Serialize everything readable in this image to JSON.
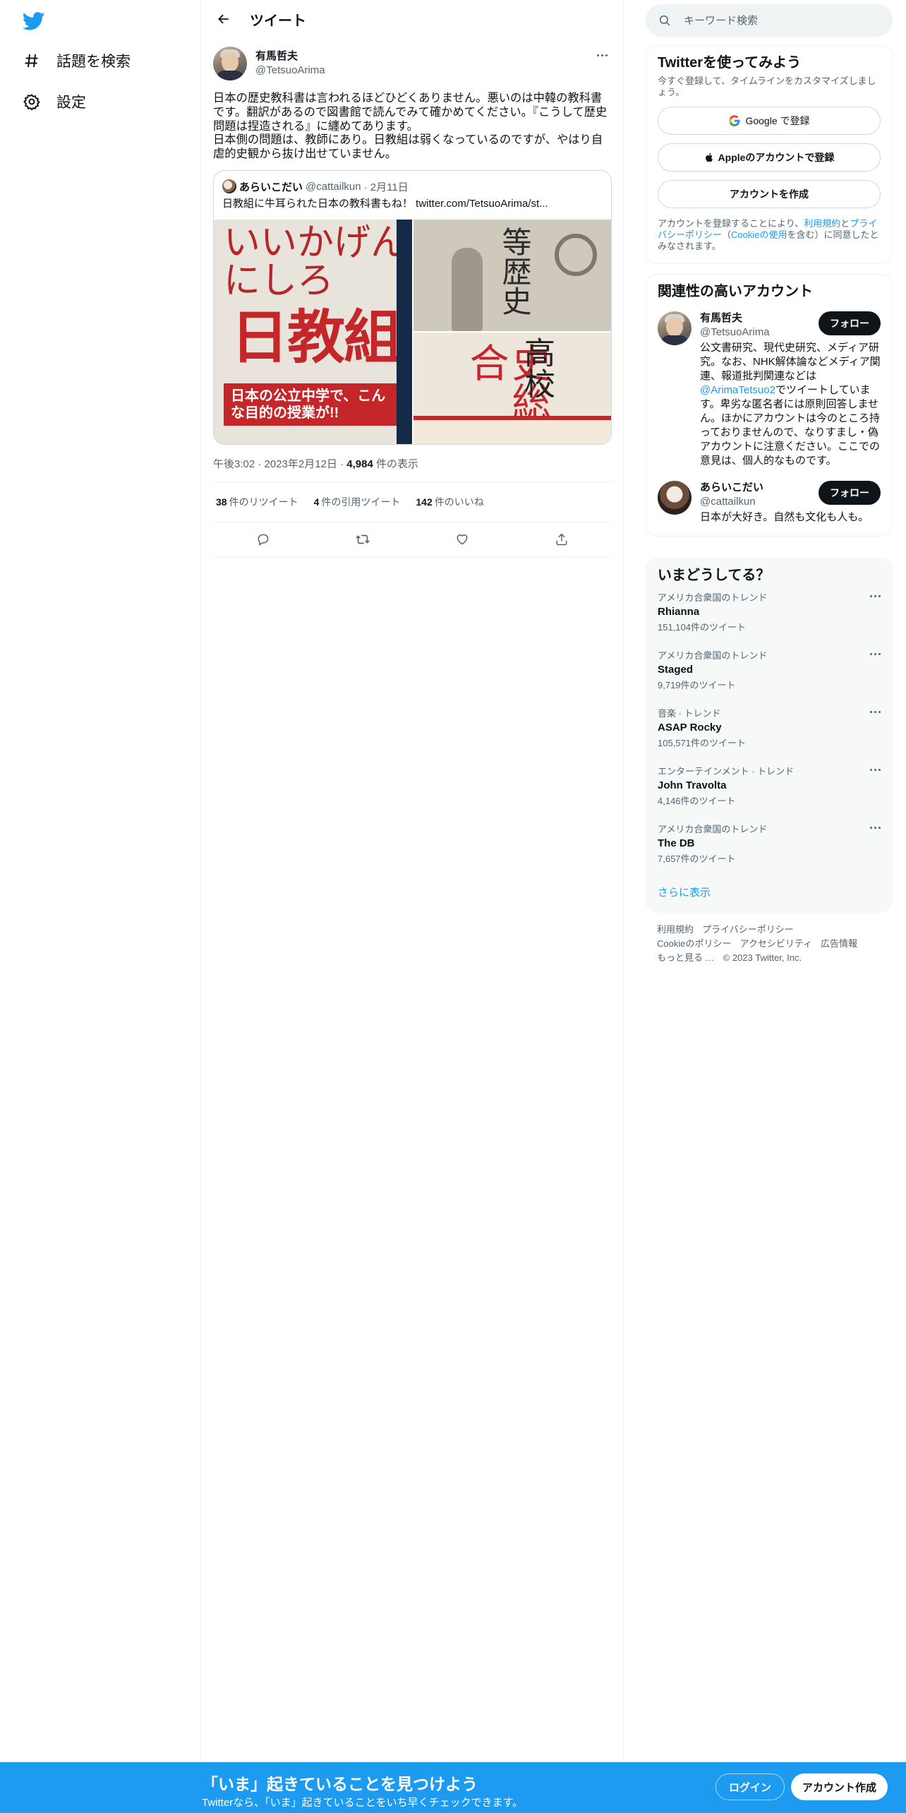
{
  "leftnav": {
    "logo_icon": "twitter-bird-icon",
    "items": [
      {
        "icon": "hashtag-icon",
        "label": "話題を検索"
      },
      {
        "icon": "gear-icon",
        "label": "設定"
      }
    ]
  },
  "header": {
    "back_icon": "arrow-left-icon",
    "title": "ツイート"
  },
  "tweet": {
    "author_name": "有馬哲夫",
    "author_handle": "@TetsuoArima",
    "text": "日本の歴史教科書は言われるほどひどくありません。悪いのは中韓の教科書です。翻訳があるので図書館で読んでみて確かめてください。『こうして歴史問題は捏造される』に纏めてあります。\n日本側の問題は、教師にあり。日教組は弱くなっているのですが、やはり自虐的史観から抜け出せていません。",
    "quote": {
      "author_name": "あらいこだい",
      "author_handle": "@cattailkun",
      "date": "· 2月11日",
      "text": "日教組に牛耳られた日本の教科書もね！ twitter.com/TetsuoArima/st...",
      "images": {
        "img1_title": "いいかげんにしろ",
        "img1_main": "日教組",
        "img1_band": "日本の公立中学で、こんな目的の授業が!!",
        "img2_text": "等歴史",
        "img3_main": "史総合",
        "img3_side": "高校"
      }
    },
    "time": "午後3:02 · 2023年2月12日 · ",
    "views_count": "4,984",
    "views_label": " 件の表示",
    "retweets_count": "38",
    "retweets_label": "件のリツイート",
    "quotes_count": "4",
    "quotes_label": "件の引用ツイート",
    "likes_count": "142",
    "likes_label": "件のいいね"
  },
  "right": {
    "search_placeholder": "キーワード検索",
    "signup": {
      "title": "Twitterを使ってみよう",
      "sub": "今すぐ登録して、タイムラインをカスタマイズしましょう。",
      "google": "Google で登録",
      "apple": "Appleのアカウントで登録",
      "create": "アカウントを作成",
      "legal_pre": "アカウントを登録することにより、",
      "terms": "利用規約",
      "and": "と",
      "privacy": "プライバシーポリシー",
      "cookie_open": "（",
      "cookie": "Cookieの使用",
      "cookie_close": "を含む）に同意したとみなされます。"
    },
    "related": {
      "title": "関連性の高いアカウント",
      "accounts": [
        {
          "name": "有馬哲夫",
          "handle": "@TetsuoArima",
          "follow": "フォロー",
          "bio_pre": "公文書研究、現代史研究、メディア研究。なお、NHK解体論などメディア関連、報道批判関連などは",
          "bio_link": "@ArimaTetsuo2",
          "bio_post": "でツイートしています。卑劣な匿名者には原則回答しません。ほかにアカウントは今のところ持っておりませんので、なりすまし・偽アカウントに注意ください。ここでの意見は、個人的なものです。"
        },
        {
          "name": "あらいこだい",
          "handle": "@cattailkun",
          "follow": "フォロー",
          "bio": "日本が大好き。自然も文化も人も。"
        }
      ]
    },
    "trends": {
      "title": "いまどうしてる？",
      "items": [
        {
          "category": "アメリカ合衆国のトレンド",
          "name": "Rhianna",
          "count": "151,104件のツイート"
        },
        {
          "category": "アメリカ合衆国のトレンド",
          "name": "Staged",
          "count": "9,719件のツイート"
        },
        {
          "category": "音楽 · トレンド",
          "name": "ASAP Rocky",
          "count": "105,571件のツイート"
        },
        {
          "category": "エンターテインメント · トレンド",
          "name": "John Travolta",
          "count": "4,146件のツイート"
        },
        {
          "category": "アメリカ合衆国のトレンド",
          "name": "The DB",
          "count": "7,657件のツイート"
        }
      ],
      "show_more": "さらに表示"
    },
    "footer": {
      "links": [
        "利用規約",
        "プライバシーポリシー",
        "Cookieのポリシー",
        "アクセシビリティ",
        "広告情報",
        "もっと見る …"
      ],
      "copyright": "© 2023 Twitter, Inc."
    }
  },
  "bottombar": {
    "title": "「いま」起きていることを見つけよう",
    "sub": "Twitterなら、「いま」起きていることをいち早くチェックできます。",
    "login": "ログイン",
    "signup": "アカウント作成"
  },
  "colors": {
    "accent": "#1d9bf0",
    "text": "#0f1419",
    "muted": "#536471"
  }
}
